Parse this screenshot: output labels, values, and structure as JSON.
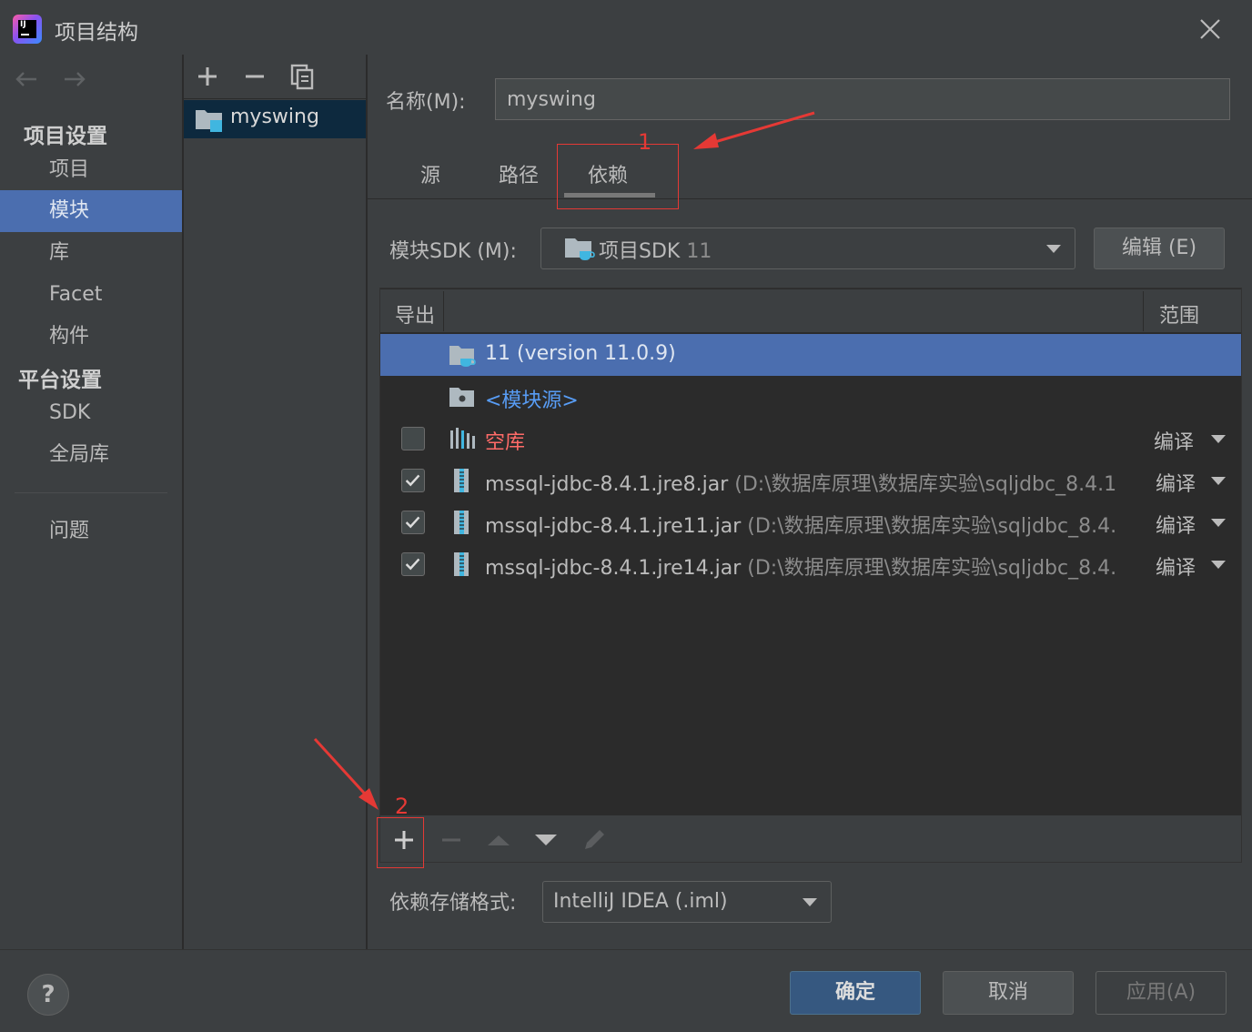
{
  "window": {
    "title": "项目结构"
  },
  "sidebar": {
    "project_settings_title": "项目设置",
    "project_items": [
      {
        "label": "项目"
      },
      {
        "label": "模块",
        "selected": true
      },
      {
        "label": "库"
      },
      {
        "label": "Facet"
      },
      {
        "label": "构件"
      }
    ],
    "platform_settings_title": "平台设置",
    "platform_items": [
      {
        "label": "SDK"
      },
      {
        "label": "全局库"
      }
    ],
    "problems": "问题"
  },
  "modules": {
    "items": [
      {
        "label": "myswing"
      }
    ]
  },
  "content": {
    "name_label": "名称(M):",
    "name_value": "myswing",
    "tabs": [
      {
        "label": "源"
      },
      {
        "label": "路径"
      },
      {
        "label": "依赖",
        "active": true
      }
    ],
    "sdk_label": "模块SDK (M):",
    "sdk_value": "项目SDK",
    "sdk_version": "11",
    "edit_button": "编辑 (E)",
    "table": {
      "col_export": "导出",
      "col_scope": "范围",
      "rows": [
        {
          "name": "11 (version 11.0.9)",
          "path": "",
          "scope": "",
          "checkbox": "none",
          "icon": "jdk-folder-icon"
        },
        {
          "name": "<模块源>",
          "path": "",
          "scope": "",
          "checkbox": "none",
          "icon": "source-folder-icon"
        },
        {
          "name": "空库",
          "path": "",
          "scope": "编译",
          "checkbox": "unchecked",
          "icon": "library-icon"
        },
        {
          "name": "mssql-jdbc-8.4.1.jre8.jar",
          "path": "(D:\\数据库原理\\数据库实验\\sqljdbc_8.4.1",
          "scope": "编译",
          "checkbox": "checked",
          "icon": "jar-icon"
        },
        {
          "name": "mssql-jdbc-8.4.1.jre11.jar",
          "path": "(D:\\数据库原理\\数据库实验\\sqljdbc_8.4.",
          "scope": "编译",
          "checkbox": "checked",
          "icon": "jar-icon"
        },
        {
          "name": "mssql-jdbc-8.4.1.jre14.jar",
          "path": "(D:\\数据库原理\\数据库实验\\sqljdbc_8.4.",
          "scope": "编译",
          "checkbox": "checked",
          "icon": "jar-icon"
        }
      ]
    },
    "format_label": "依赖存储格式:",
    "format_value": "IntelliJ IDEA (.iml)"
  },
  "buttons": {
    "ok": "确定",
    "cancel": "取消",
    "apply": "应用(A)",
    "help": "?"
  },
  "annotations": {
    "one": "1",
    "two": "2"
  },
  "colors": {
    "background": "#3c3f41",
    "selection": "#4b6eaf",
    "table_bg": "#2b2b2b",
    "link_blue": "#589df6",
    "error_red": "#ff6b68",
    "annotation_red": "#e53935",
    "primary_button": "#365880"
  }
}
